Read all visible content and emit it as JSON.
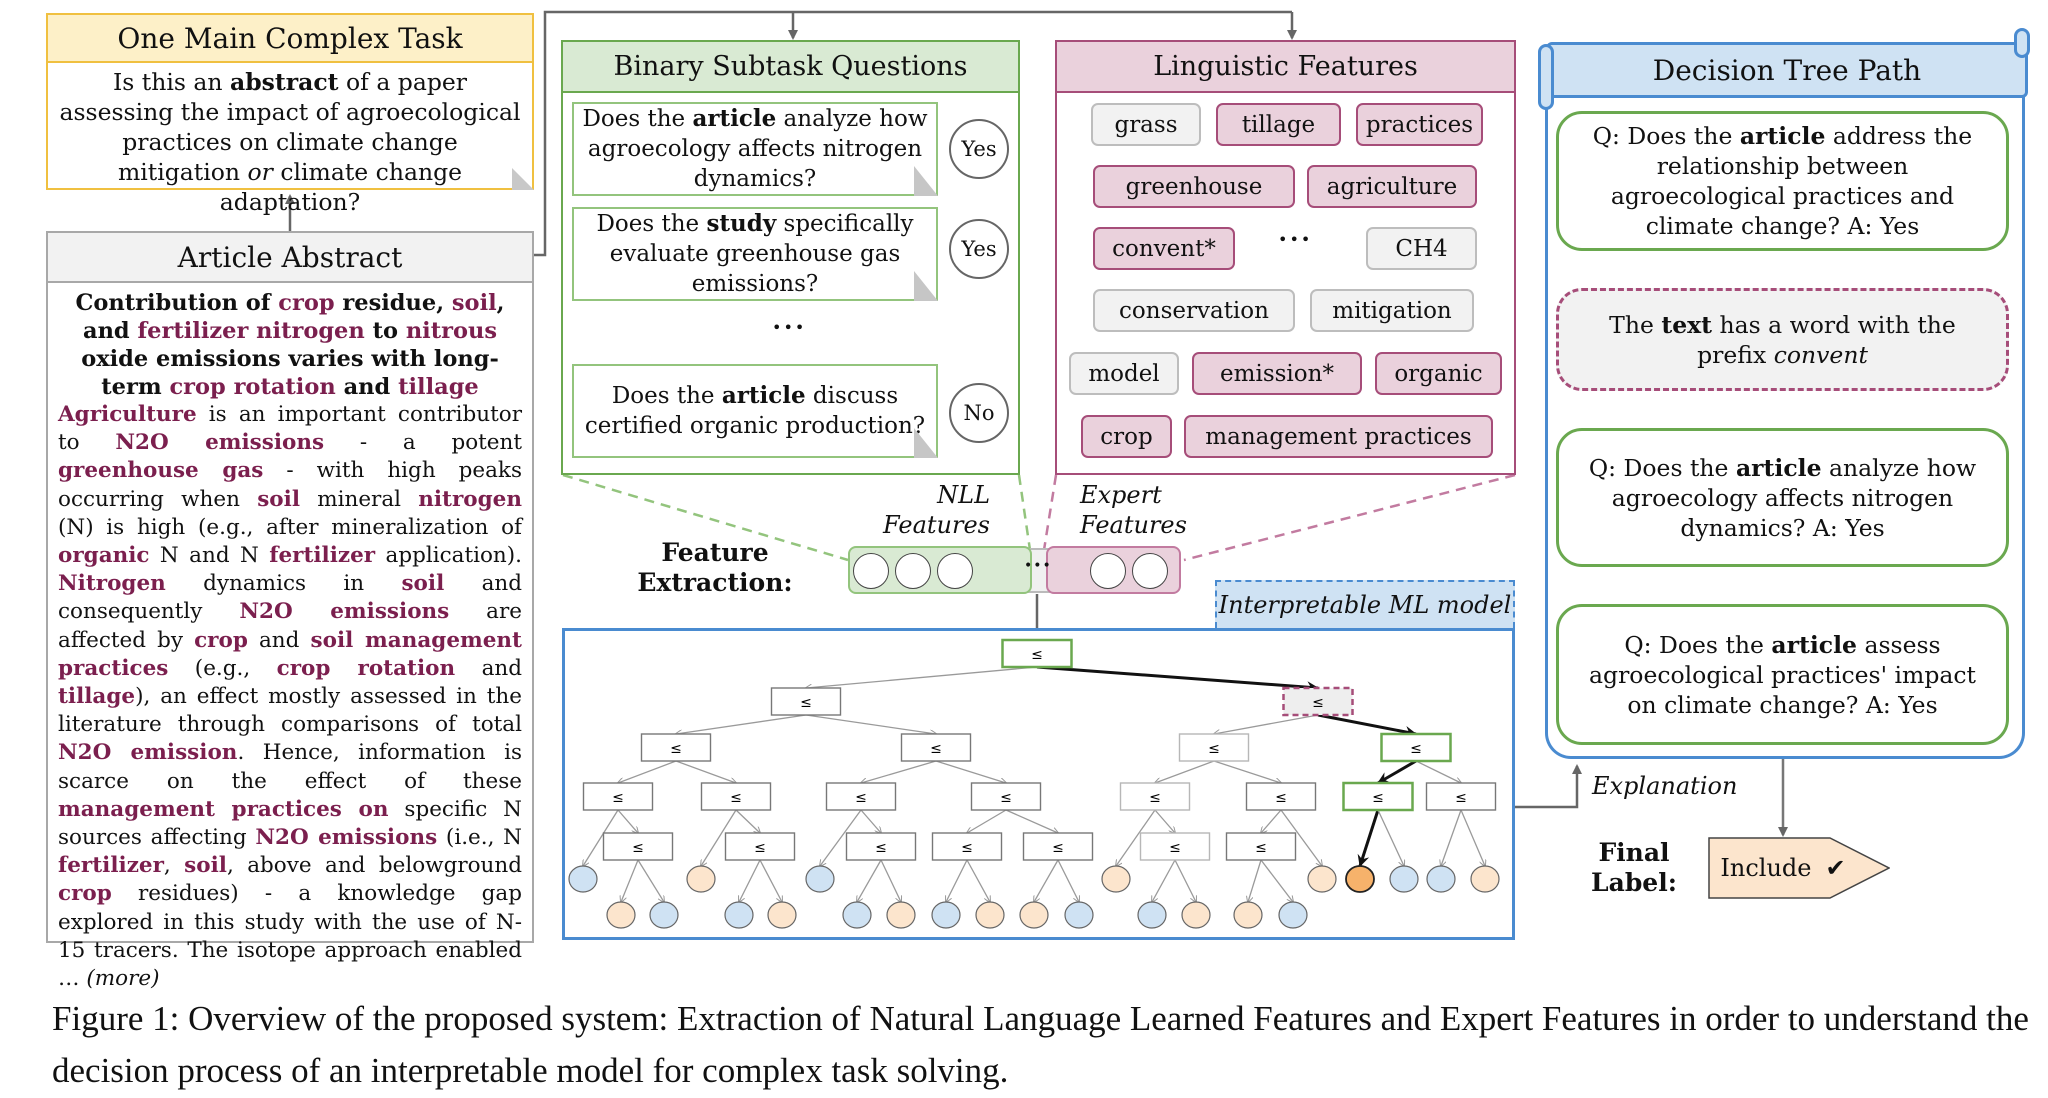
{
  "main_task": {
    "title": "One Main Complex Task",
    "question_parts": [
      "Is this an ",
      "abstract",
      " of a paper assessing the impact of agroecological practices on climate change mitigation ",
      "or",
      " climate change adaptation?"
    ]
  },
  "abstract": {
    "header": "Article Abstract",
    "title_segments": [
      {
        "t": "Contribution of ",
        "h": false
      },
      {
        "t": "crop",
        "h": true
      },
      {
        "t": " residue, ",
        "h": false
      },
      {
        "t": "soil",
        "h": true
      },
      {
        "t": ", and ",
        "h": false
      },
      {
        "t": "fertilizer nitrogen",
        "h": true
      },
      {
        "t": " to ",
        "h": false
      },
      {
        "t": "nitrous",
        "h": true
      },
      {
        "t": " oxide emissions varies with long-term ",
        "h": false
      },
      {
        "t": "crop rotation",
        "h": true
      },
      {
        "t": " and ",
        "h": false
      },
      {
        "t": "tillage",
        "h": true
      }
    ],
    "body_segments": [
      {
        "t": "Agriculture",
        "h": true
      },
      {
        "t": " is an important contributor to ",
        "h": false
      },
      {
        "t": "N2O emissions",
        "h": true
      },
      {
        "t": " - a potent ",
        "h": false
      },
      {
        "t": "greenhouse gas",
        "h": true
      },
      {
        "t": " - with high peaks occurring when ",
        "h": false
      },
      {
        "t": "soil",
        "h": true
      },
      {
        "t": " mineral ",
        "h": false
      },
      {
        "t": "nitrogen",
        "h": true
      },
      {
        "t": " (N) is high (e.g., after mineralization of ",
        "h": false
      },
      {
        "t": "organic",
        "h": true
      },
      {
        "t": " N and N ",
        "h": false
      },
      {
        "t": "fertilizer",
        "h": true
      },
      {
        "t": " application). ",
        "h": false
      },
      {
        "t": "Nitrogen",
        "h": true
      },
      {
        "t": " dynamics in ",
        "h": false
      },
      {
        "t": "soil",
        "h": true
      },
      {
        "t": " and consequently ",
        "h": false
      },
      {
        "t": "N2O emissions",
        "h": true
      },
      {
        "t": " are affected by ",
        "h": false
      },
      {
        "t": "crop",
        "h": true
      },
      {
        "t": " and ",
        "h": false
      },
      {
        "t": "soil management practices",
        "h": true
      },
      {
        "t": " (e.g., ",
        "h": false
      },
      {
        "t": "crop rotation",
        "h": true
      },
      {
        "t": " and ",
        "h": false
      },
      {
        "t": "tillage",
        "h": true
      },
      {
        "t": "), an effect mostly assessed in the literature through comparisons of total ",
        "h": false
      },
      {
        "t": "N2O emission",
        "h": true
      },
      {
        "t": ". Hence, information is scarce on the effect of these ",
        "h": false
      },
      {
        "t": "management practices on",
        "h": true
      },
      {
        "t": " specific N sources affecting ",
        "h": false
      },
      {
        "t": "N2O emissions",
        "h": true
      },
      {
        "t": " (i.e., N ",
        "h": false
      },
      {
        "t": "fertilizer",
        "h": true
      },
      {
        "t": ", ",
        "h": false
      },
      {
        "t": "soil",
        "h": true
      },
      {
        "t": ", above and belowground ",
        "h": false
      },
      {
        "t": "crop",
        "h": true
      },
      {
        "t": " residues) - a knowledge gap explored in this study with the use of N-15 tracers. The isotope approach enabled … ",
        "h": false
      }
    ],
    "more_label": "(more)"
  },
  "binary": {
    "title": "Binary Subtask Questions",
    "questions": [
      {
        "pre": "Does the ",
        "bold": "article",
        "post": " analyze how agroecology affects nitrogen dynamics?",
        "answer": "Yes"
      },
      {
        "pre": "Does the ",
        "bold": "study",
        "post": " specifically evaluate greenhouse gas emissions?",
        "answer": "Yes"
      },
      {
        "pre": "Does the ",
        "bold": "article",
        "post": " discuss certified organic production?",
        "answer": "No"
      }
    ],
    "ellipsis": "•••"
  },
  "linguistic": {
    "title": "Linguistic Features",
    "tags": [
      {
        "label": "grass",
        "kind": "nll"
      },
      {
        "label": "tillage",
        "kind": "exp"
      },
      {
        "label": "practices",
        "kind": "exp"
      },
      {
        "label": "greenhouse",
        "kind": "exp"
      },
      {
        "label": "agriculture",
        "kind": "exp"
      },
      {
        "label": "convent*",
        "kind": "exp"
      },
      {
        "label": "CH4",
        "kind": "nll"
      },
      {
        "label": "conservation",
        "kind": "nll"
      },
      {
        "label": "mitigation",
        "kind": "nll"
      },
      {
        "label": "model",
        "kind": "nll"
      },
      {
        "label": "emission*",
        "kind": "exp"
      },
      {
        "label": "organic",
        "kind": "exp"
      },
      {
        "label": "crop",
        "kind": "exp"
      },
      {
        "label": "management practices",
        "kind": "exp"
      }
    ],
    "ellipsis": "•••"
  },
  "feature_extraction": {
    "label_line1": "Feature",
    "label_line2": "Extraction:",
    "nll_line1": "NLL",
    "nll_line2": "Features",
    "expert_line1": "Expert",
    "expert_line2": "Features",
    "nll_count": 3,
    "expert_count": 2,
    "ellipsis": "•••"
  },
  "ml_model": {
    "label": "Interpretable ML model",
    "node_symbol": "≤",
    "colors": {
      "blue_leaf": "#cfe2f3",
      "orange_leaf": "#fce5cd",
      "selected_leaf": "#f6b26b",
      "path_green": "#6aa84f",
      "expert_pink": "#a64d79"
    }
  },
  "decision_path": {
    "title": "Decision Tree Path",
    "steps": [
      {
        "type": "question",
        "pre": "Q: Does the ",
        "bold": "article",
        "post": " address the relationship between agroecological practices and climate change? A: Yes"
      },
      {
        "type": "feature",
        "pre": "The ",
        "bold": "text",
        "post": " has a word with the prefix ",
        "italic": "convent"
      },
      {
        "type": "question",
        "pre": "Q: Does the ",
        "bold": "article",
        "post": " analyze how agroecology affects nitrogen dynamics? A: Yes"
      },
      {
        "type": "question",
        "pre": "Q: Does the ",
        "bold": "article",
        "post": " assess agroecological practices' impact on climate change? A: Yes"
      }
    ]
  },
  "explanation_label": "Explanation",
  "final": {
    "label_line1": "Final",
    "label_line2": "Label:",
    "value": "Include",
    "check_icon": "✔"
  },
  "caption": "Figure 1: Overview of the proposed system: Extraction of Natural Language Learned Features and Expert Features in order to understand the decision process of an interpretable model for complex task solving."
}
